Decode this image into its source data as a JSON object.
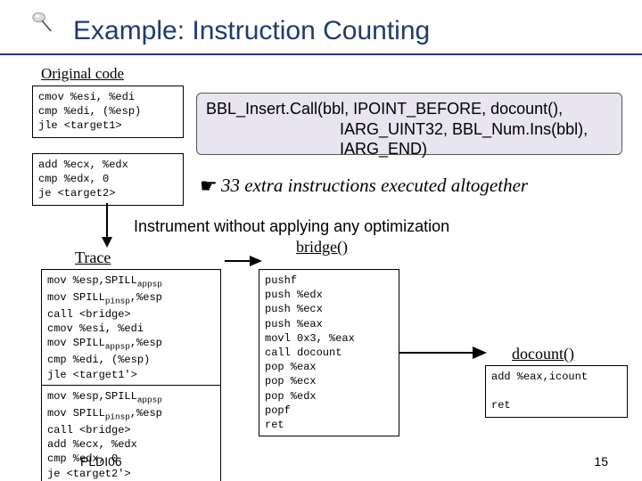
{
  "title": "Example: Instruction Counting",
  "original": {
    "heading": "Original code",
    "block1": "cmov %esi, %edi\ncmp %edi, (%esp)\njle <target1>",
    "block2": "add %ecx, %edx\ncmp %edx, 0\nje <target2>"
  },
  "api_call": {
    "line1": "BBL_Insert.Call(bbl, IPOINT_BEFORE, docount(),",
    "line2": "IARG_UINT32, BBL_Num.Ins(bbl),",
    "line3": "IARG_END)"
  },
  "extra_note": "33 extra instructions executed altogether",
  "instrument_note": "Instrument without applying any optimization",
  "trace": {
    "heading": "Trace",
    "block1_html": "mov %esp,SPILL<sub>appsp</sub>\nmov SPILL<sub>pinsp</sub>,%esp\ncall &lt;bridge&gt;\ncmov %esi, %edi\nmov SPILL<sub>appsp</sub>,%esp\ncmp %edi, (%esp)\njle &lt;target1'&gt;",
    "block2_html": "mov %esp,SPILL<sub>appsp</sub>\nmov SPILL<sub>pinsp</sub>,%esp\ncall &lt;bridge&gt;\nadd %ecx, %edx\ncmp %edx, 0\nje &lt;target2'&gt;"
  },
  "bridge": {
    "heading": "bridge()",
    "code": "pushf\npush %edx\npush %ecx\npush %eax\nmovl 0x3, %eax\ncall docount\npop %eax\npop %ecx\npop %edx\npopf\nret"
  },
  "docount": {
    "heading": "docount()",
    "code": "add %eax,icount\n\nret"
  },
  "footer": "PLDI06",
  "page": "15",
  "icons": {
    "hand": "☛"
  }
}
